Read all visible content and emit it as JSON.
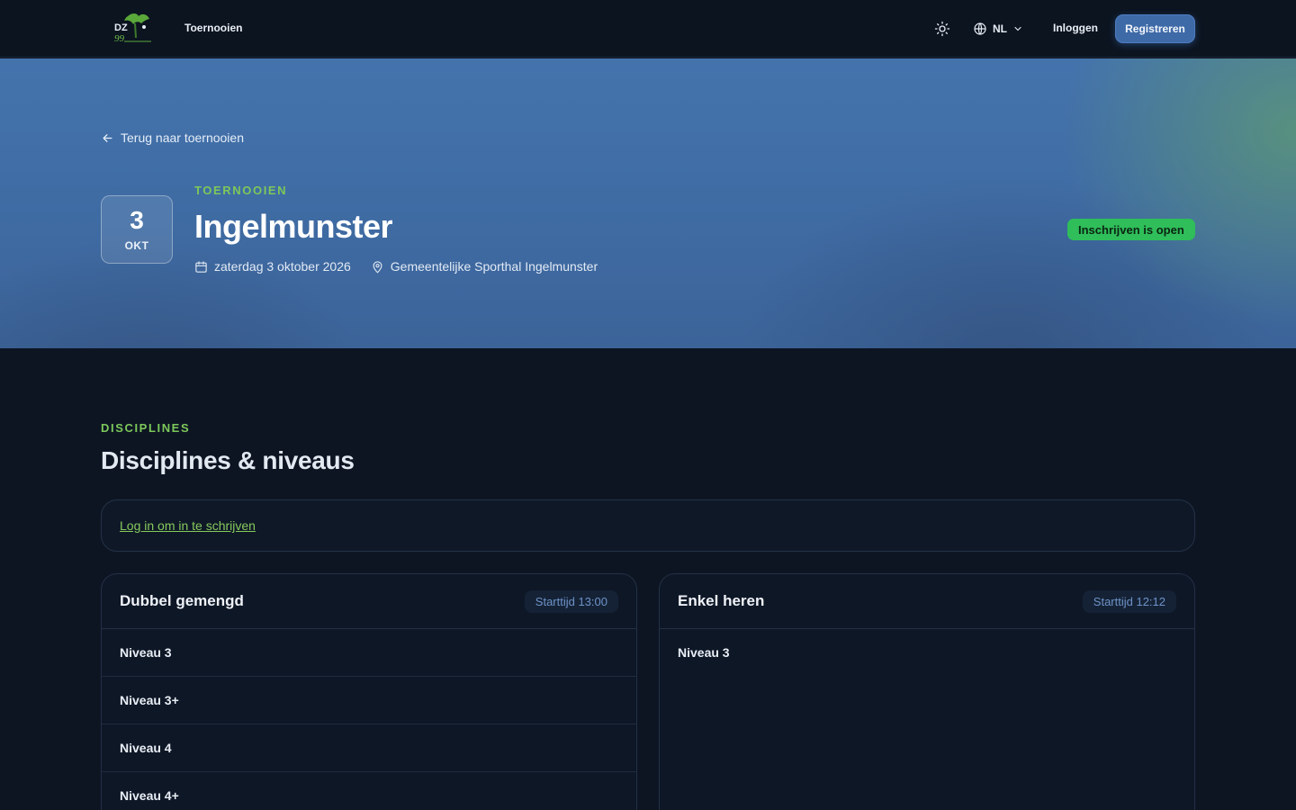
{
  "nav": {
    "logo_text": "DZ",
    "tournaments_link": "Toernooien",
    "language": "NL",
    "login": "Inloggen",
    "register": "Registreren"
  },
  "hero": {
    "back_link": "Terug naar toernooien",
    "date_day": "3",
    "date_month": "OKT",
    "kicker": "TOERNOOIEN",
    "title": "Ingelmunster",
    "date_full": "zaterdag 3 oktober 2026",
    "location": "Gemeentelijke Sporthal Ingelmunster",
    "status": "Inschrijven is open"
  },
  "disciplines": {
    "kicker": "DISCIPLINES",
    "title": "Disciplines & niveaus",
    "login_prompt": "Log in om in te schrijven",
    "cards": [
      {
        "title": "Dubbel gemengd",
        "start_time": "Starttijd 13:00",
        "levels": [
          "Niveau 3",
          "Niveau 3+",
          "Niveau 4",
          "Niveau 4+"
        ]
      },
      {
        "title": "Enkel heren",
        "start_time": "Starttijd 12:12",
        "levels": [
          "Niveau 3"
        ]
      }
    ]
  },
  "colors": {
    "accent_green": "#7cc85a",
    "status_green": "#2fbe5a",
    "primary_blue": "#3f6aa8",
    "background": "#0d1523"
  },
  "icons": [
    "logo-icon",
    "sun-icon",
    "globe-icon",
    "chevron-down-icon",
    "arrow-left-icon",
    "calendar-icon",
    "map-pin-icon"
  ]
}
